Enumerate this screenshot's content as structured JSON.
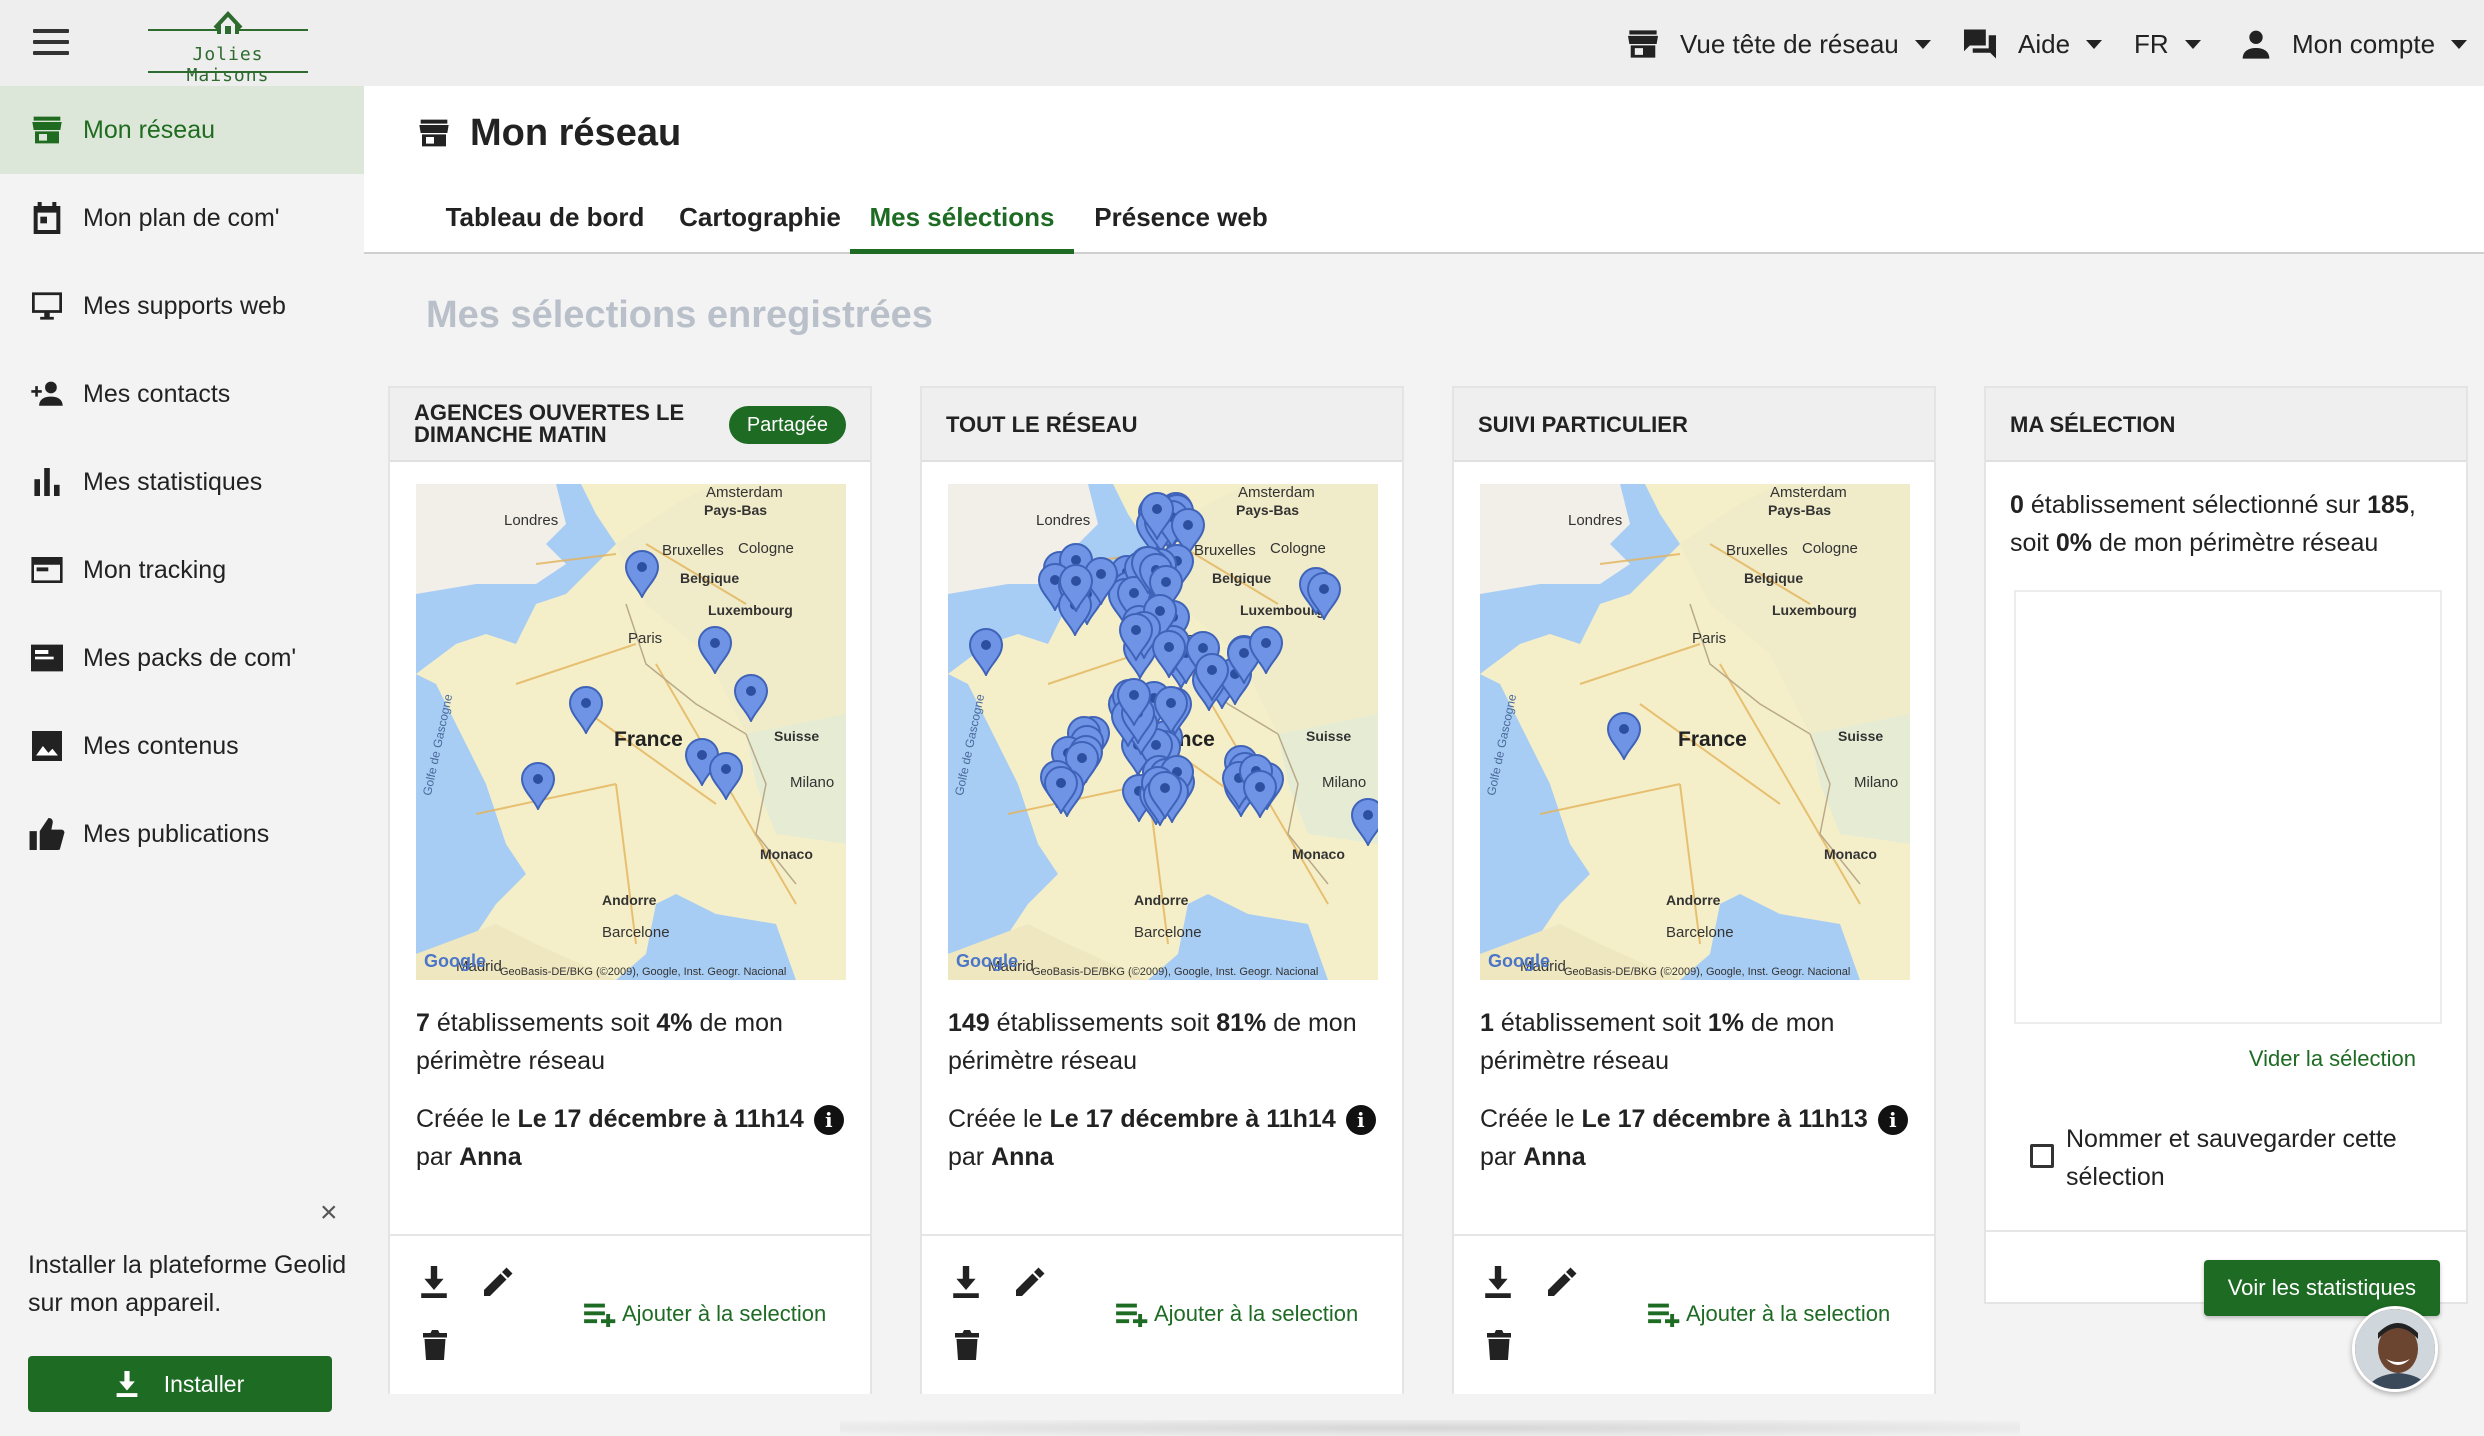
{
  "app": {
    "logo_text": "Jolies Maisons"
  },
  "topbar": {
    "network_view": "Vue tête de réseau",
    "help": "Aide",
    "language": "FR",
    "account": "Mon compte"
  },
  "sidebar": {
    "items": [
      {
        "label": "Mon réseau",
        "icon": "store-icon",
        "active": true
      },
      {
        "label": "Mon plan de com'",
        "icon": "calendar-icon"
      },
      {
        "label": "Mes supports web",
        "icon": "monitor-icon"
      },
      {
        "label": "Mes contacts",
        "icon": "person-add-icon"
      },
      {
        "label": "Mes statistiques",
        "icon": "bar-chart-icon"
      },
      {
        "label": "Mon tracking",
        "icon": "browser-window-icon"
      },
      {
        "label": "Mes packs de com'",
        "icon": "pack-icon"
      },
      {
        "label": "Mes contenus",
        "icon": "image-icon"
      },
      {
        "label": "Mes publications",
        "icon": "thumb-up-icon"
      }
    ],
    "install": {
      "text": "Installer la plateforme Geolid sur mon appareil.",
      "button": "Installer",
      "close": "×"
    }
  },
  "main": {
    "title": "Mon réseau",
    "tabs": [
      {
        "label": "Tableau de bord"
      },
      {
        "label": "Cartographie"
      },
      {
        "label": "Mes sélections",
        "active": true
      },
      {
        "label": "Présence web"
      }
    ],
    "section_title": "Mes sélections enregistrées"
  },
  "map_labels": {
    "amsterdam": "Amsterdam",
    "paysbas": "Pays-Bas",
    "londres": "Londres",
    "bruxelles": "Bruxelles",
    "cologne": "Cologne",
    "belgique": "Belgique",
    "luxembourg": "Luxembourg",
    "paris": "Paris",
    "france": "France",
    "suisse": "Suisse",
    "milano": "Milano",
    "monaco": "Monaco",
    "andorre": "Andorre",
    "barcelone": "Barcelone",
    "madrid": "Madrid",
    "gascogne": "Golfe de Gascogne",
    "google": "Google",
    "copyright": "GeoBasis-DE/BKG (©2009), Google, Inst. Geogr. Nacional"
  },
  "cards": [
    {
      "title_line1": "Agences ouvertes le",
      "title_line2": "dimanche matin",
      "badge": "Partagée",
      "count": "7",
      "count_label": " établissements soit ",
      "percent": "4%",
      "suffix": " de mon périmètre réseau",
      "created_prefix": "Créée le ",
      "created_date": "Le 17 décembre à 11h14",
      "by_prefix": "par ",
      "author": "Anna",
      "add_label": "Ajouter à la selection"
    },
    {
      "title_line1": "Tout le réseau",
      "count": "149",
      "count_label": " établissements soit ",
      "percent": "81%",
      "suffix": " de mon périmètre réseau",
      "created_prefix": "Créée le ",
      "created_date": "Le 17 décembre à 11h14",
      "by_prefix": "par ",
      "author": "Anna",
      "add_label": "Ajouter à la selection"
    },
    {
      "title_line1": "Suivi particulier",
      "count": "1",
      "count_label": " établissement soit ",
      "percent": "1%",
      "suffix": " de mon périmètre réseau",
      "created_prefix": "Créée le ",
      "created_date": "Le 17 décembre à 11h13",
      "by_prefix": "par ",
      "author": "Anna",
      "add_label": "Ajouter à la selection"
    }
  ],
  "my_selection": {
    "title": "Ma sélection",
    "selected": "0",
    "selected_label": " établissement sélectionné sur ",
    "total": "185",
    "sep": ", soit ",
    "percent": "0%",
    "suffix": " de mon périmètre réseau",
    "clear": "Vider la sélection",
    "save_label": "Nommer et sauvegarder cette sélection",
    "stats_button": "Voir les statistiques"
  },
  "colors": {
    "accent": "#1e6b24",
    "active_bg": "#dde7d9",
    "pin": "#6f94e6"
  }
}
